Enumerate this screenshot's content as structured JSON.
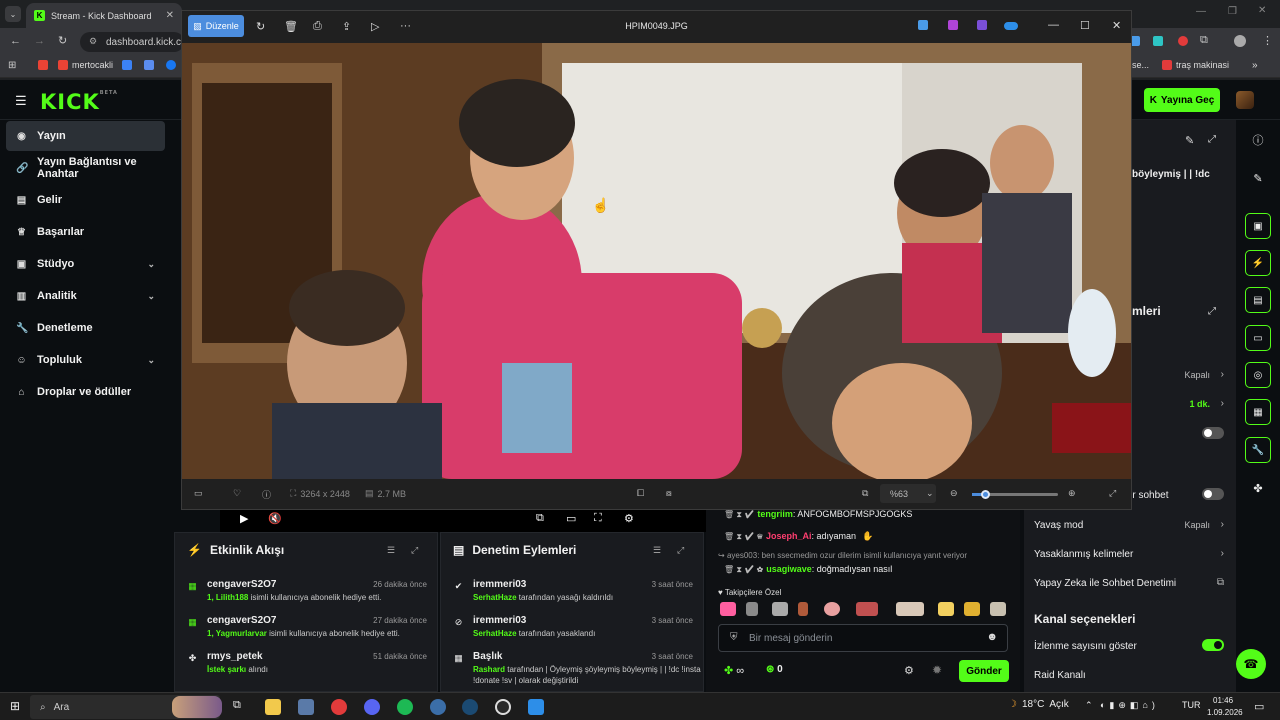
{
  "browser": {
    "tab_title": "Stream - Kick Dashboard",
    "url": "dashboard.kick.com",
    "bookmarks": [
      {
        "label": "mertocakli"
      },
      {
        "label": "se..."
      },
      {
        "label": "traş makinasi"
      }
    ]
  },
  "kick": {
    "logo": "KICK",
    "logo_badge": "BETA",
    "go_live_label": "Yayına Geç",
    "sidebar": [
      {
        "label": "Yayın",
        "icon": "broadcast-icon",
        "active": true
      },
      {
        "label": "Yayın Bağlantısı ve Anahtar",
        "icon": "link-icon"
      },
      {
        "label": "Gelir",
        "icon": "revenue-icon"
      },
      {
        "label": "Başarılar",
        "icon": "trophy-icon"
      },
      {
        "label": "Stüdyo",
        "icon": "studio-icon",
        "expand": true
      },
      {
        "label": "Analitik",
        "icon": "analytics-icon",
        "expand": true
      },
      {
        "label": "Denetleme",
        "icon": "wrench-icon"
      },
      {
        "label": "Topluluk",
        "icon": "community-icon",
        "expand": true
      },
      {
        "label": "Droplar ve ödüller",
        "icon": "gift-icon"
      }
    ]
  },
  "viewer": {
    "edit_label": "Düzenle",
    "filename": "HPIM0049.JPG",
    "dimensions": "3264 x 2448",
    "filesize": "2.7 MB",
    "zoom": "%63"
  },
  "activity_feed": {
    "title": "Etkinlik Akışı",
    "items": [
      {
        "user": "cengaverS2O7",
        "time": "26 dakika önce",
        "highlight": "1, Lilith188",
        "text": " isimli kullanıcıya abonelik hediye etti."
      },
      {
        "user": "cengaverS2O7",
        "time": "27 dakika önce",
        "highlight": "1, Yagmurlarvar",
        "text": " isimli kullanıcıya abonelik hediye etti."
      },
      {
        "user": "rmys_petek",
        "time": "51 dakika önce",
        "highlight": "İstek şarkı",
        "text": " alındı"
      }
    ]
  },
  "moderation": {
    "title": "Denetim Eylemleri",
    "items": [
      {
        "user": "iremmeri03",
        "time": "3 saat önce",
        "highlight": "SerhatHaze",
        "text": " tarafından yasağı kaldırıldı"
      },
      {
        "user": "iremmeri03",
        "time": "3 saat önce",
        "highlight": "SerhatHaze",
        "text": " tarafından yasaklandı"
      },
      {
        "user": "Başlık",
        "time": "3 saat önce",
        "highlight": "Rashard",
        "text": " tarafından | Öyleymiş şöyleymiş böyleymiş | | !dc !insta !donate !sv | olarak değiştirildi"
      }
    ]
  },
  "chat": {
    "messages": [
      {
        "user": "tengriim",
        "text": ": ANFOGMBOFMSPJGOGKS",
        "color": "#53fc18"
      },
      {
        "user": "Joseph_Ai",
        "text": ": adıyaman",
        "color": "#ff3e70"
      },
      {
        "user": "ayes003",
        "text": ": ben ssecmedim ozur dilerim isimli kullanıcıya yanıt veriyor",
        "color": "#999999"
      },
      {
        "user": "usagiwave",
        "text": ": doğmadıysan nasıl",
        "color": "#53fc18"
      }
    ],
    "subscriber_emotes_label": "Takipçilere Özel",
    "input_placeholder": "Bir mesaj gönderin",
    "points": "0",
    "send_label": "Gönder"
  },
  "right_panel": {
    "title_snippet": "böyleymiş | | !dc",
    "section_snippet": "mleri",
    "rows": [
      {
        "label": "",
        "value": "Kapalı"
      },
      {
        "label": "t",
        "value": "1 dk."
      },
      {
        "label": "",
        "value": ""
      },
      {
        "label": "Takipçiler sohbet",
        "value": ""
      },
      {
        "label": "Yavaş mod",
        "value": "Kapalı"
      },
      {
        "label": "Yasaklanmış kelimeler",
        "value": ""
      },
      {
        "label": "Yapay Zeka ile Sohbet Denetimi",
        "value": ""
      }
    ],
    "channel_options_title": "Kanal seçenekleri",
    "show_viewers_label": "İzlenme sayısını göster",
    "raid_label": "Raid Kanalı"
  },
  "taskbar": {
    "search_label": "Ara",
    "weather": "18°C",
    "weather_desc": "Açık",
    "lang": "TUR",
    "time": "01:46",
    "date": "1.09.2026"
  },
  "colors": {
    "kick_green": "#53fc18",
    "viewer_accent": "#4c8dde"
  }
}
